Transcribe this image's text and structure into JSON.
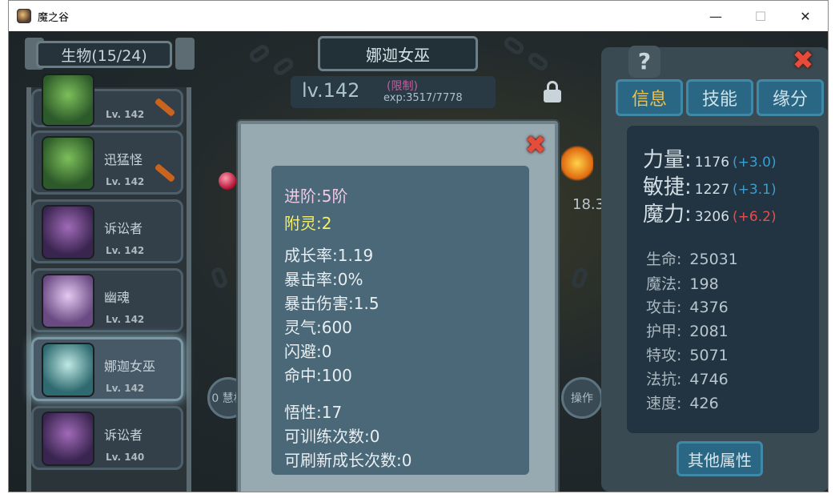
{
  "window": {
    "title": "魔之谷",
    "controls": {
      "minimize": "—",
      "maximize": "☐",
      "close": "✕"
    }
  },
  "creature_list": {
    "title": "生物(15/24)",
    "items": [
      {
        "name": "",
        "level": "Lv. 142",
        "portrait": "green",
        "equipped_icon": "sword-icon"
      },
      {
        "name": "迅猛怪",
        "level": "Lv. 142",
        "portrait": "green",
        "equipped_icon": "sword-icon"
      },
      {
        "name": "诉讼者",
        "level": "Lv. 142",
        "portrait": "purple"
      },
      {
        "name": "幽魂",
        "level": "Lv. 142",
        "portrait": "lilac"
      },
      {
        "name": "娜迦女巫",
        "level": "Lv. 142",
        "portrait": "teal",
        "selected": true
      },
      {
        "name": "诉讼者",
        "level": "Lv. 140",
        "portrait": "purple"
      }
    ]
  },
  "creature": {
    "name": "娜迦女巫",
    "level": "lv.142",
    "limit": "(限制)",
    "exp": "exp:3517/7778"
  },
  "background": {
    "number_partial": "18.3",
    "left_button_partial": "0 慧机",
    "right_button_partial": "操作"
  },
  "right_panel": {
    "help_icon": "?",
    "tabs": [
      {
        "label": "信息",
        "active": true
      },
      {
        "label": "技能"
      },
      {
        "label": "缘分"
      }
    ],
    "attributes": [
      {
        "label": "力量:",
        "value": "1176",
        "bonus": "(+3.0)",
        "bonus_color": "#3a9ed0"
      },
      {
        "label": "敏捷:",
        "value": "1227",
        "bonus": "(+3.1)",
        "bonus_color": "#3a9ed0"
      },
      {
        "label": "魔力:",
        "value": "3206",
        "bonus": "(+6.2)",
        "bonus_color": "#e05050"
      }
    ],
    "stats": [
      {
        "label": "生命:",
        "value": "25031"
      },
      {
        "label": "魔法:",
        "value": "198"
      },
      {
        "label": "攻击:",
        "value": "4376"
      },
      {
        "label": "护甲:",
        "value": "2081"
      },
      {
        "label": "特攻:",
        "value": "5071"
      },
      {
        "label": "法抗:",
        "value": "4746"
      },
      {
        "label": "速度:",
        "value": "426"
      }
    ],
    "other_button": "其他属性"
  },
  "modal": {
    "close": "✖",
    "lines": [
      "进阶:5阶",
      "附灵:2",
      "成长率:1.19",
      "暴击率:0%",
      "暴击伤害:1.5",
      "灵气:600",
      "闪避:0",
      "命中:100",
      "悟性:17",
      "可训练次数:0",
      "可刷新成长次数:0"
    ]
  }
}
